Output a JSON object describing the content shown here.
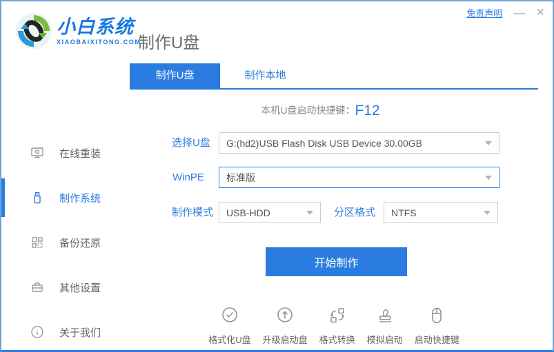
{
  "window": {
    "disclaimer_label": "免责声明",
    "minimize_glyph": "—",
    "close_glyph": "×"
  },
  "brand": {
    "name": "小白系统",
    "domain": "XIAOBAIXITONG.COM",
    "logo_icon": "recycle-swirl-logo"
  },
  "page_title": "制作U盘",
  "sidebar": {
    "items": [
      {
        "label": "在线重装",
        "icon": "monitor-icon",
        "active": false
      },
      {
        "label": "制作系统",
        "icon": "usb-drive-icon",
        "active": true
      },
      {
        "label": "备份还原",
        "icon": "backup-grid-icon",
        "active": false
      },
      {
        "label": "其他设置",
        "icon": "briefcase-icon",
        "active": false
      },
      {
        "label": "关于我们",
        "icon": "info-circle-icon",
        "active": false
      }
    ]
  },
  "tabs": [
    {
      "label": "制作U盘",
      "active": true
    },
    {
      "label": "制作本地",
      "active": false
    }
  ],
  "boot_hotkey": {
    "label": "本机U盘启动快捷键：",
    "value": "F12"
  },
  "form": {
    "usb_select": {
      "label": "选择U盘",
      "value": "G:(hd2)USB Flash Disk USB Device 30.00GB"
    },
    "winpe": {
      "label": "WinPE",
      "value": "标准版"
    },
    "mode": {
      "label": "制作模式",
      "value": "USB-HDD"
    },
    "partition": {
      "label": "分区格式",
      "value": "NTFS"
    }
  },
  "start_button_label": "开始制作",
  "tools": [
    {
      "label": "格式化U盘",
      "icon": "check-circle-icon"
    },
    {
      "label": "升级启动盘",
      "icon": "upgrade-arrow-circle-icon"
    },
    {
      "label": "格式转换",
      "icon": "format-convert-icon"
    },
    {
      "label": "模拟启动",
      "icon": "stamp-icon"
    },
    {
      "label": "启动快捷键",
      "icon": "mouse-icon"
    }
  ],
  "colors": {
    "primary_blue": "#2b7ce0",
    "window_border": "#6ea3d8",
    "label_gray": "#666666",
    "dropdown_border": "#cccccc"
  }
}
